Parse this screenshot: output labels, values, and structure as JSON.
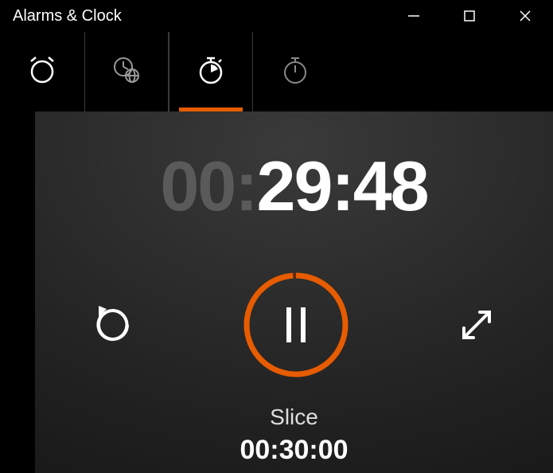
{
  "window": {
    "title": "Alarms & Clock"
  },
  "tabs": {
    "items": [
      {
        "name": "alarm"
      },
      {
        "name": "world-clock"
      },
      {
        "name": "timer"
      },
      {
        "name": "stopwatch"
      }
    ],
    "active_index": 2
  },
  "timer": {
    "elapsed_dim": "00:",
    "elapsed_bright": "29:48",
    "name": "Slice",
    "total": "00:30:00",
    "state": "running",
    "accent_color": "#e65c00"
  },
  "controls": {
    "reset": "reset",
    "pause": "pause",
    "expand": "expand"
  }
}
